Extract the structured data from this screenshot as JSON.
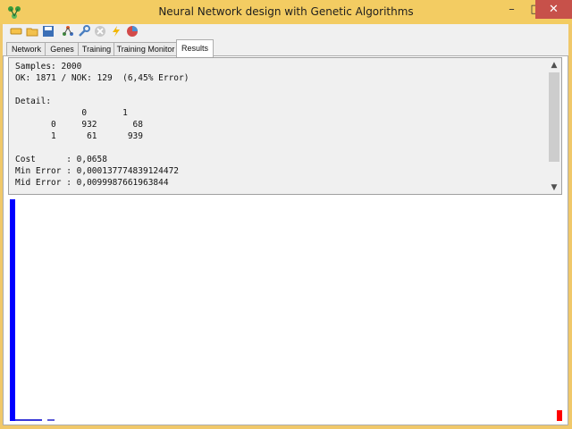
{
  "window": {
    "title": "Neural Network design with Genetic Algorithms",
    "minimize_label": "–",
    "maximize_label": "□",
    "close_label": "✕"
  },
  "toolbar": {
    "icons": [
      "new-icon",
      "open-folder-icon",
      "save-icon",
      "network-icon",
      "wrench-icon",
      "stop-icon",
      "lightning-icon",
      "chart-icon"
    ]
  },
  "tabs": [
    {
      "label": "Network",
      "active": false
    },
    {
      "label": "Genes",
      "active": false
    },
    {
      "label": "Training",
      "active": false
    },
    {
      "label": "Training Monitor",
      "active": false
    },
    {
      "label": "Results",
      "active": true
    }
  ],
  "results": {
    "text": "Samples: 2000\nOK: 1871 / NOK: 129  (6,45% Error)\n\nDetail:\n             0       1\n       0     932       68\n       1      61      939\n\nCost      : 0,0658\nMin Error : 0,000137774839124472\nMid Error : 0,0099987661963844"
  },
  "colors": {
    "title_bar": "#f3cc62",
    "close_button": "#c7514a",
    "blue_bar": "#0000ff",
    "red_bar": "#ff0000"
  }
}
